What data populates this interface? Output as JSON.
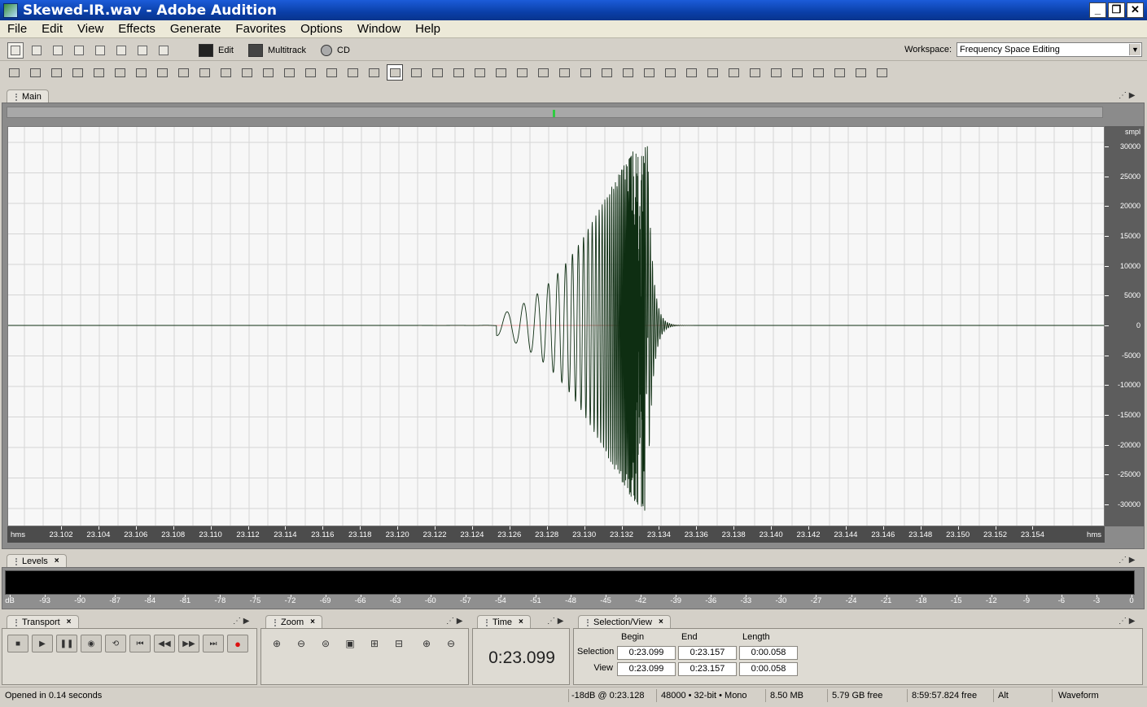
{
  "window": {
    "title": "Skewed-IR.wav - Adobe Audition",
    "min": "_",
    "max": "❐",
    "close": "✕"
  },
  "menu": [
    "File",
    "Edit",
    "View",
    "Effects",
    "Generate",
    "Favorites",
    "Options",
    "Window",
    "Help"
  ],
  "modes": {
    "edit": "Edit",
    "multitrack": "Multitrack",
    "cd": "CD"
  },
  "workspace": {
    "label": "Workspace:",
    "value": "Frequency Space Editing"
  },
  "main_panel": {
    "tab": "Main"
  },
  "waveform": {
    "y_unit": "smpl",
    "y_labels": [
      "30000",
      "25000",
      "20000",
      "15000",
      "10000",
      "5000",
      "0",
      "-5000",
      "-10000",
      "-15000",
      "-20000",
      "-25000",
      "-30000"
    ],
    "x_unit": "hms",
    "x_labels": [
      "23.102",
      "23.104",
      "23.106",
      "23.108",
      "23.110",
      "23.112",
      "23.114",
      "23.116",
      "23.118",
      "23.120",
      "23.122",
      "23.124",
      "23.126",
      "23.128",
      "23.130",
      "23.132",
      "23.134",
      "23.136",
      "23.138",
      "23.140",
      "23.142",
      "23.144",
      "23.146",
      "23.148",
      "23.150",
      "23.152",
      "23.154"
    ],
    "colors": {
      "wave": "#0e2e12",
      "grid": "#d5d5d5",
      "bg": "#f7f7f7"
    }
  },
  "levels": {
    "tab": "Levels",
    "scale": [
      "dB",
      "-93",
      "-90",
      "-87",
      "-84",
      "-81",
      "-78",
      "-75",
      "-72",
      "-69",
      "-66",
      "-63",
      "-60",
      "-57",
      "-54",
      "-51",
      "-48",
      "-45",
      "-42",
      "-39",
      "-36",
      "-33",
      "-30",
      "-27",
      "-24",
      "-21",
      "-18",
      "-15",
      "-12",
      "-9",
      "-6",
      "-3",
      "0"
    ]
  },
  "transport": {
    "tab": "Transport"
  },
  "zoom": {
    "tab": "Zoom"
  },
  "time": {
    "tab": "Time",
    "value": "0:23.099"
  },
  "selection_view": {
    "tab": "Selection/View",
    "headers": {
      "begin": "Begin",
      "end": "End",
      "length": "Length"
    },
    "selection": {
      "label": "Selection",
      "begin": "0:23.099",
      "end": "0:23.157",
      "length": "0:00.058"
    },
    "view": {
      "label": "View",
      "begin": "0:23.099",
      "end": "0:23.157",
      "length": "0:00.058"
    }
  },
  "status": {
    "message": "Opened in 0.14 seconds",
    "cursor": "-18dB @   0:23.128",
    "format": "48000 • 32-bit • Mono",
    "size": "8.50 MB",
    "free": "5.79 GB free",
    "free_time": "8:59:57.824 free",
    "key": "Alt",
    "view": "Waveform"
  }
}
